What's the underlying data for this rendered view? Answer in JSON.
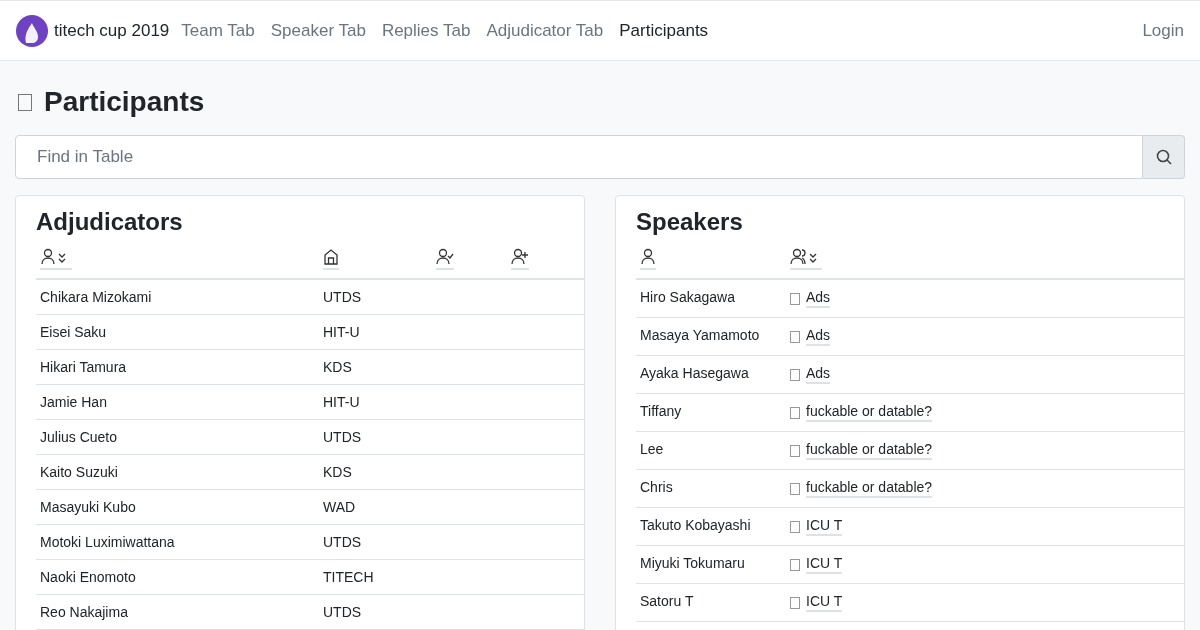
{
  "navbar": {
    "brand": "titech cup 2019",
    "links": [
      {
        "label": "Team Tab",
        "selected": false
      },
      {
        "label": "Speaker Tab",
        "selected": false
      },
      {
        "label": "Replies Tab",
        "selected": false
      },
      {
        "label": "Adjudicator Tab",
        "selected": false
      },
      {
        "label": "Participants",
        "selected": true
      }
    ],
    "login": "Login"
  },
  "page_title": "Participants",
  "search": {
    "placeholder": "Find in Table"
  },
  "adjudicators": {
    "title": "Adjudicators",
    "rows": [
      {
        "name": "Chikara Mizokami",
        "institution": "UTDS"
      },
      {
        "name": "Eisei Saku",
        "institution": "HIT-U"
      },
      {
        "name": "Hikari Tamura",
        "institution": "KDS"
      },
      {
        "name": "Jamie Han",
        "institution": "HIT-U"
      },
      {
        "name": "Julius Cueto",
        "institution": "UTDS"
      },
      {
        "name": "Kaito Suzuki",
        "institution": "KDS"
      },
      {
        "name": "Masayuki Kubo",
        "institution": "WAD"
      },
      {
        "name": "Motoki Luximiwattana",
        "institution": "UTDS"
      },
      {
        "name": "Naoki Enomoto",
        "institution": "TITECH"
      },
      {
        "name": "Reo Nakajima",
        "institution": "UTDS"
      }
    ]
  },
  "speakers": {
    "title": "Speakers",
    "rows": [
      {
        "name": "Hiro Sakagawa",
        "team": "Ads"
      },
      {
        "name": "Masaya Yamamoto",
        "team": "Ads"
      },
      {
        "name": "Ayaka Hasegawa",
        "team": "Ads"
      },
      {
        "name": "Tiffany",
        "team": "fuckable or datable?"
      },
      {
        "name": "Lee",
        "team": "fuckable or datable?"
      },
      {
        "name": "Chris",
        "team": "fuckable or datable?"
      },
      {
        "name": "Takuto Kobayashi",
        "team": "ICU T"
      },
      {
        "name": "Miyuki Tokumaru",
        "team": "ICU T"
      },
      {
        "name": "Satoru T",
        "team": "ICU T"
      }
    ]
  }
}
